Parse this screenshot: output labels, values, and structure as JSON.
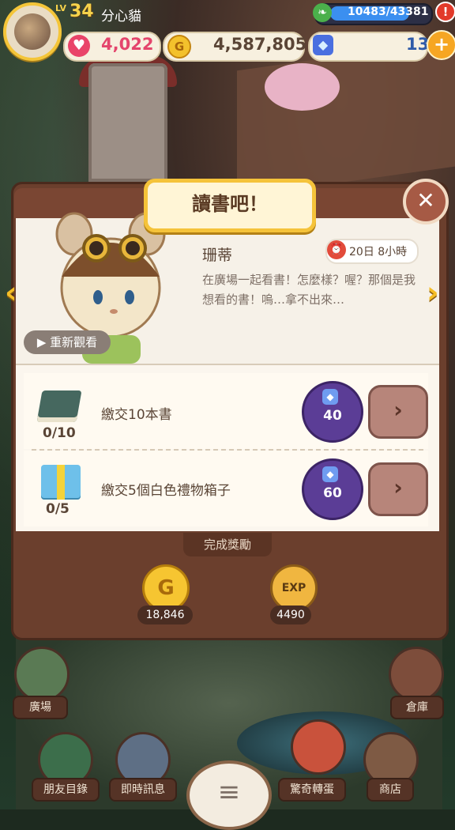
{
  "player": {
    "level_prefix": "LV",
    "level": "34",
    "name": "分心貓",
    "exp_text": "10483/43381",
    "hearts": "4,022",
    "coins": "4,587,805",
    "gems": "13",
    "alert_badge": "!",
    "plus_symbol": "+"
  },
  "dialog": {
    "title": "讀書吧！",
    "close_symbol": "✕",
    "npc_name": "珊蒂",
    "timer": "20日 8小時",
    "story": "在廣場一起看書！怎麼樣？喔？那個是我想看的書！嗚…拿不出來…",
    "replay_label": "▶ 重新觀看",
    "prev_symbol": "‹",
    "next_symbol": "›",
    "tasks": [
      {
        "progress": "0/10",
        "label": "繳交10本書",
        "gem_cost": "40",
        "go_symbol": "›"
      },
      {
        "progress": "0/5",
        "label": "繳交5個白色禮物箱子",
        "gem_cost": "60",
        "go_symbol": "›"
      }
    ],
    "reward_title": "完成獎勵",
    "rewards": [
      {
        "icon": "coin-icon",
        "glyph": "G",
        "value": "18,846"
      },
      {
        "icon": "exp-icon",
        "glyph": "EXP",
        "value": "4490"
      }
    ]
  },
  "nav": {
    "plaza": "廣場",
    "warehouse": "倉庫",
    "friends": "朋友目錄",
    "messages": "即時訊息",
    "gacha": "驚奇轉蛋",
    "shop": "商店",
    "menu_symbol": "≡"
  },
  "colors": {
    "panel": "#6b3f2d",
    "title_border": "#f5c33a",
    "gem_button": "#5b3d96",
    "arrow": "#f5bd26"
  }
}
